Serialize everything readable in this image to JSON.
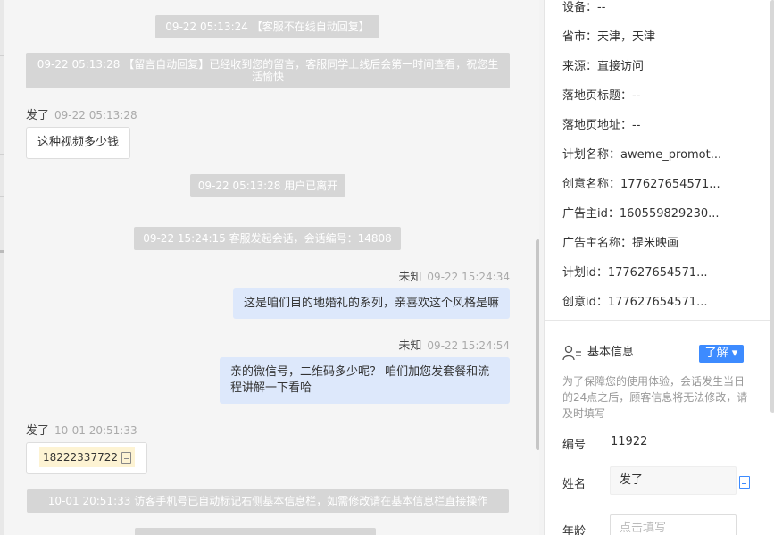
{
  "chat": {
    "sys_offline": "09-22 05:13:24 【客服不在线自动回复】",
    "sys_leave_msg": "09-22 05:13:28 【留言自动回复】已经收到您的留言，客服同学上线后会第一时间查看，祝您生活愉快",
    "msg1_sender": "发了",
    "msg1_time": "09-22 05:13:28",
    "msg1_text": "这种视频多少钱",
    "sys_user_left": "09-22 05:13:28 用户已离开",
    "sys_session": "09-22 15:24:15 客服发起会话，会话编号：14808",
    "msg2_sender": "未知",
    "msg2_time": "09-22 15:24:34",
    "msg2_text": "这是咱们目的地婚礼的系列，亲喜欢这个风格是嘛",
    "msg3_sender": "未知",
    "msg3_time": "09-22 15:24:54",
    "msg3_text": "亲的微信号，二维码多少呢？ 咱们加您发套餐和流程讲解一下看哈",
    "msg4_sender": "发了",
    "msg4_time": "10-01 20:51:33",
    "msg4_phone": "18222337722",
    "sys_phone_marked": "10-01 20:51:33 访客手机号已自动标记右侧基本信息栏，如需修改请在基本信息栏直接操作"
  },
  "visitor": {
    "device": "设备：--",
    "province_city": "省市：天津，天津",
    "source": "来源：直接访问",
    "landing_title": "落地页标题：--",
    "landing_url": "落地页地址：--",
    "plan_name": "计划名称：aweme_promot...",
    "creative_name": "创意名称：177627654571...",
    "advertiser_id": "广告主id：160559829230...",
    "advertiser_name": "广告主名称：提米映画",
    "plan_id": "计划id：177627654571...",
    "creative_id": "创意id：177627654571..."
  },
  "basic_info": {
    "title": "基本信息",
    "learn_btn": "了解 ▾",
    "notice": "为了保障您的使用体验，会话发生当日的24点之后，顾客信息将无法修改，请及时填写",
    "id_label": "编号",
    "id_value": "11922",
    "name_label": "姓名",
    "name_value": "发了",
    "age_label": "年龄",
    "age_placeholder": "点击填写"
  },
  "colors": {
    "accent": "#3d8bff",
    "outgoing_bubble": "#dde8fb",
    "system_bubble": "#d6d6d6"
  }
}
